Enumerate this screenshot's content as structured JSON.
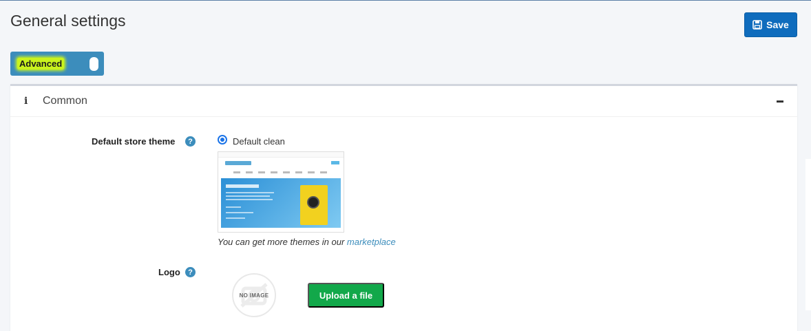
{
  "header": {
    "title": "General settings",
    "save_label": "Save"
  },
  "advanced_toggle": {
    "label": "Advanced",
    "enabled": true
  },
  "section": {
    "title": "Common",
    "expanded": true
  },
  "fields": {
    "theme": {
      "label": "Default store theme",
      "help": "?",
      "options": [
        {
          "label": "Default clean",
          "selected": true
        }
      ],
      "note_prefix": "You can get more themes in our",
      "note_link": "marketplace"
    },
    "logo": {
      "label": "Logo",
      "help": "?",
      "placeholder_text": "NO IMAGE",
      "upload_label": "Upload a file"
    }
  },
  "colors": {
    "primary": "#0f6cbd",
    "toggle": "#3c8dbc",
    "highlight": "#c9f31d",
    "upload": "#12a84a",
    "link": "#3c8dbc"
  }
}
